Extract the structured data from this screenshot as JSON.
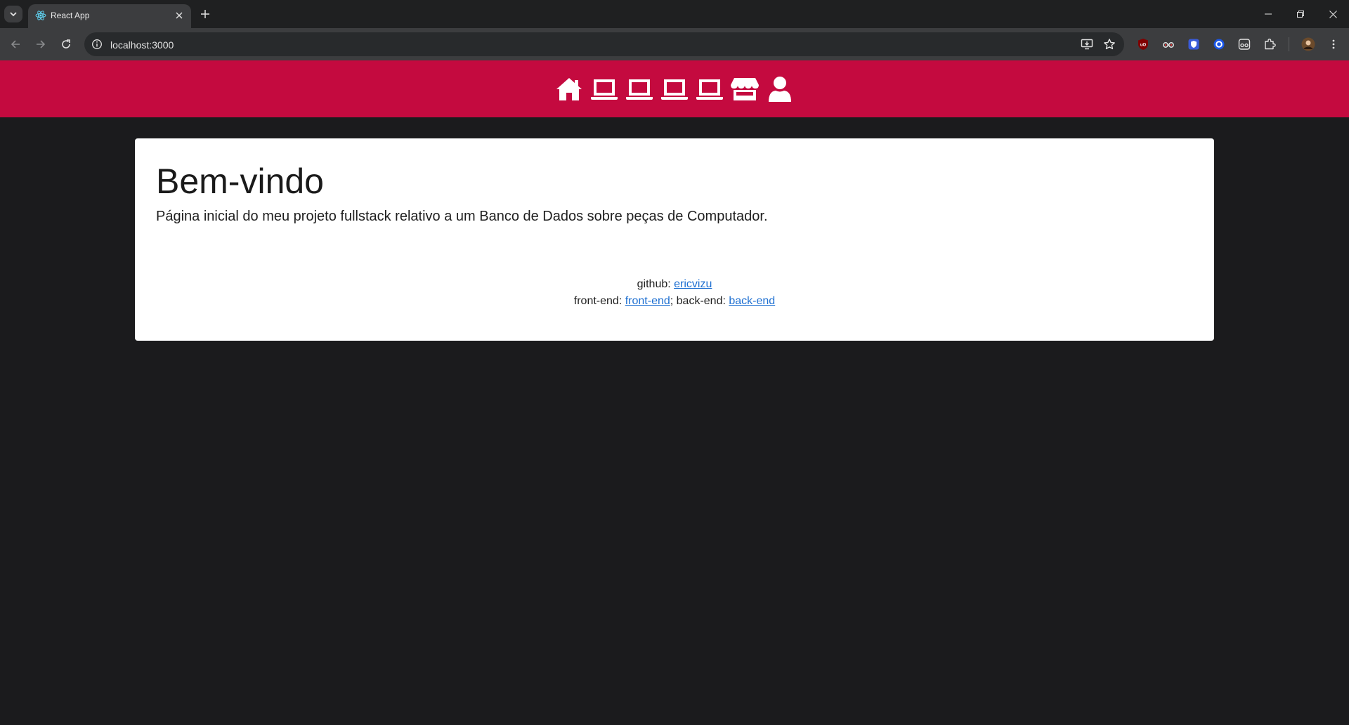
{
  "browser": {
    "tab_title": "React App",
    "url": "localhost:3000"
  },
  "navbar": {
    "background": "#c40a3f",
    "icons": [
      "home-icon",
      "laptop-icon",
      "laptop-icon",
      "laptop-icon",
      "laptop-icon",
      "store-icon",
      "user-icon"
    ]
  },
  "content": {
    "title": "Bem-vindo",
    "lead": "Página inicial do meu projeto fullstack relativo a um Banco de Dados sobre peças de Computador.",
    "github_label": "github: ",
    "github_link": "ericvizu",
    "frontend_label": "front-end: ",
    "frontend_link": "front-end",
    "separator": "; ",
    "backend_label": "back-end: ",
    "backend_link": "back-end"
  }
}
